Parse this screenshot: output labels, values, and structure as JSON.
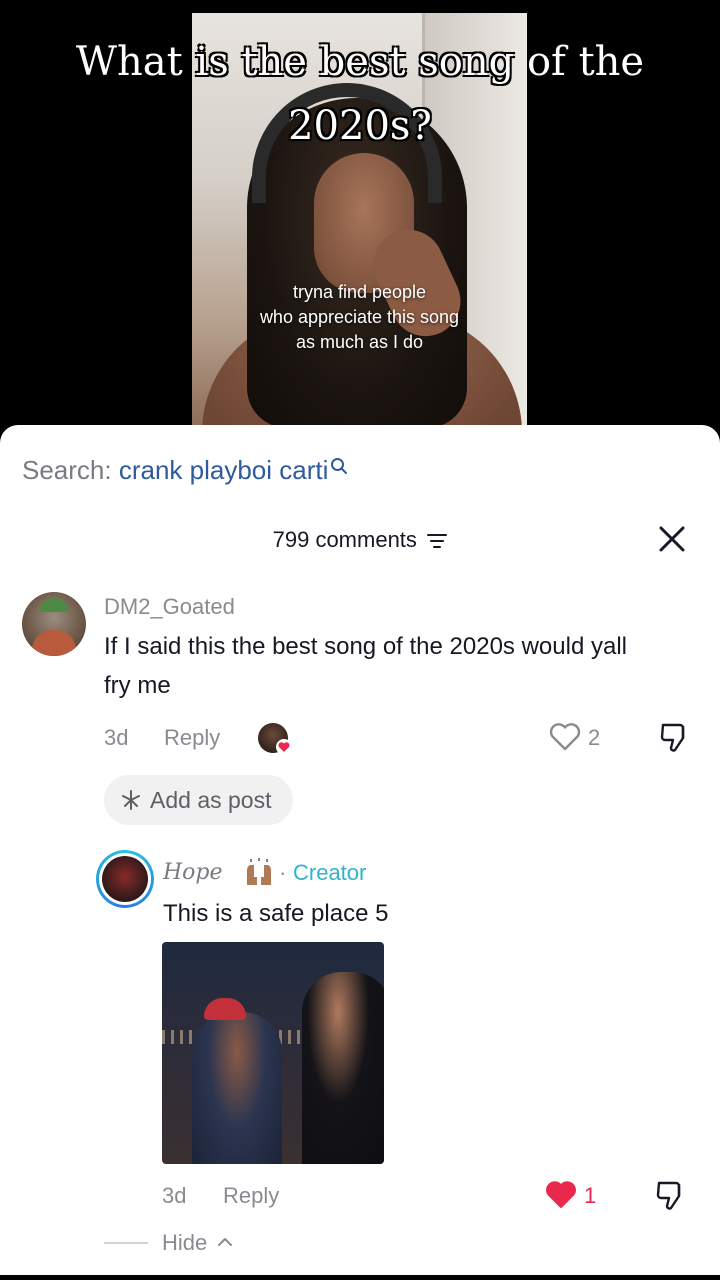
{
  "video": {
    "title_line1": "What is the best song of the",
    "title_line2": "2020s?",
    "caption_line1": "tryna find people",
    "caption_line2": "who appreciate this song",
    "caption_line3": "as much as I do"
  },
  "search": {
    "label": "Search: ",
    "term": "crank playboi carti",
    "icon": "search-icon"
  },
  "comments_header": {
    "count_label": "799 comments",
    "filter_icon": "filter-icon",
    "close_icon": "close-icon"
  },
  "comments": [
    {
      "username": "DM2_Goated",
      "text": "If I said this the best song of the 2020s would yall fry me",
      "time": "3d",
      "reply_label": "Reply",
      "like_count": "2",
      "liked": false,
      "add_as_post_label": "Add as post"
    }
  ],
  "replies": [
    {
      "username": "Hope",
      "emoji_icon": "raised-hands-icon",
      "separator": "·",
      "badge": "Creator",
      "text": "This is a safe place 5",
      "time": "3d",
      "reply_label": "Reply",
      "like_count": "1",
      "liked": true
    }
  ],
  "hide_label": "Hide",
  "colors": {
    "search_term": "#2f5a9e",
    "creator_badge": "#2fb4cc",
    "liked_heart": "#e8284d",
    "meta_gray": "#8a8b91"
  }
}
